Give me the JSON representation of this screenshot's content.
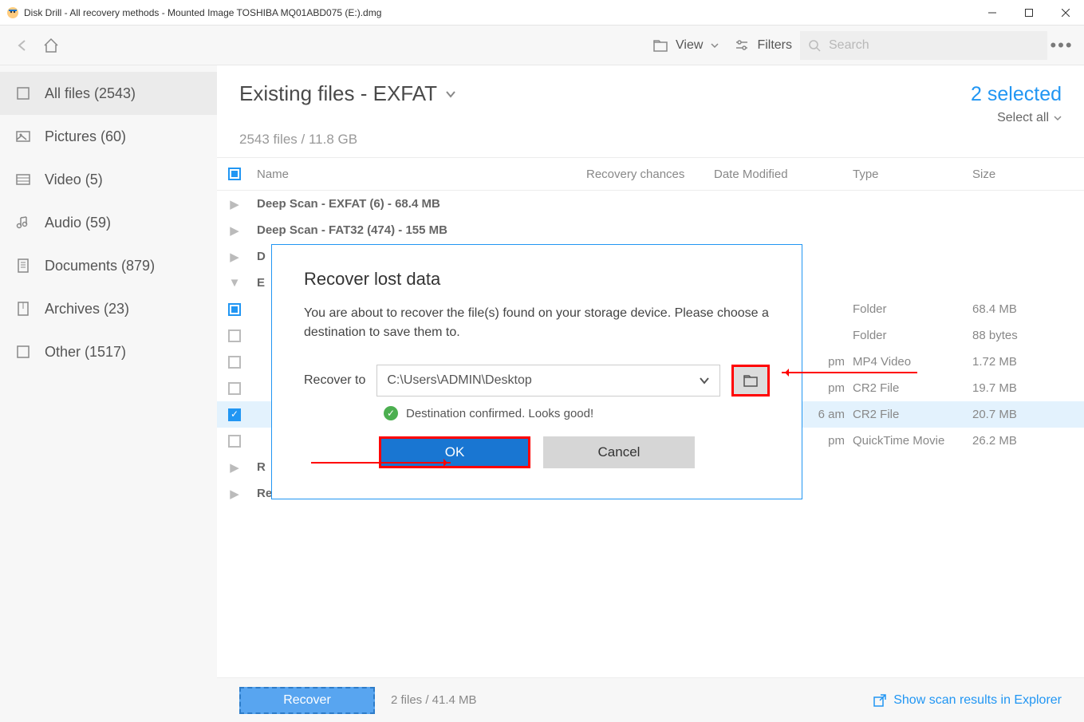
{
  "window": {
    "title": "Disk Drill - All recovery methods - Mounted Image TOSHIBA MQ01ABD075 (E:).dmg"
  },
  "toolbar": {
    "view_label": "View",
    "filters_label": "Filters",
    "search_placeholder": "Search"
  },
  "sidebar": {
    "items": [
      {
        "label": "All files (2543)"
      },
      {
        "label": "Pictures (60)"
      },
      {
        "label": "Video (5)"
      },
      {
        "label": "Audio (59)"
      },
      {
        "label": "Documents (879)"
      },
      {
        "label": "Archives (23)"
      },
      {
        "label": "Other (1517)"
      }
    ]
  },
  "header": {
    "title": "Existing files - EXFAT",
    "subtitle": "2543 files / 11.8 GB",
    "selected": "2 selected",
    "select_all": "Select all"
  },
  "columns": {
    "name": "Name",
    "recovery": "Recovery chances",
    "date": "Date Modified",
    "type": "Type",
    "size": "Size"
  },
  "groups": [
    {
      "expand": "▶",
      "label": "Deep Scan - EXFAT (6) - 68.4 MB"
    },
    {
      "expand": "▶",
      "label": "Deep Scan - FAT32 (474) - 155 MB"
    },
    {
      "expand": "▶",
      "label": "D"
    },
    {
      "expand": "▼",
      "label": "E"
    }
  ],
  "files": [
    {
      "checked": "partial",
      "date": "",
      "type": "Folder",
      "size": "68.4 MB"
    },
    {
      "checked": "false",
      "date": "",
      "type": "Folder",
      "size": "88 bytes"
    },
    {
      "checked": "false",
      "date": "pm",
      "type": "MP4 Video",
      "size": "1.72 MB"
    },
    {
      "checked": "false",
      "date": "pm",
      "type": "CR2 File",
      "size": "19.7 MB"
    },
    {
      "checked": "true",
      "date": "6 am",
      "type": "CR2 File",
      "size": "20.7 MB",
      "selected": true
    },
    {
      "checked": "false",
      "date": "pm",
      "type": "QuickTime Movie",
      "size": "26.2 MB"
    }
  ],
  "groups2": [
    {
      "expand": "▶",
      "label": "R"
    },
    {
      "expand": "▶",
      "label": "Reconstructed labeled (?)  -  "
    }
  ],
  "footer": {
    "recover": "Recover",
    "info": "2 files / 41.4 MB",
    "link": "Show scan results in Explorer"
  },
  "dialog": {
    "title": "Recover lost data",
    "text": "You are about to recover the file(s) found on your storage device. Please choose a destination to save them to.",
    "recover_to": "Recover to",
    "path": "C:\\Users\\ADMIN\\Desktop",
    "confirm": "Destination confirmed. Looks good!",
    "ok": "OK",
    "cancel": "Cancel"
  }
}
